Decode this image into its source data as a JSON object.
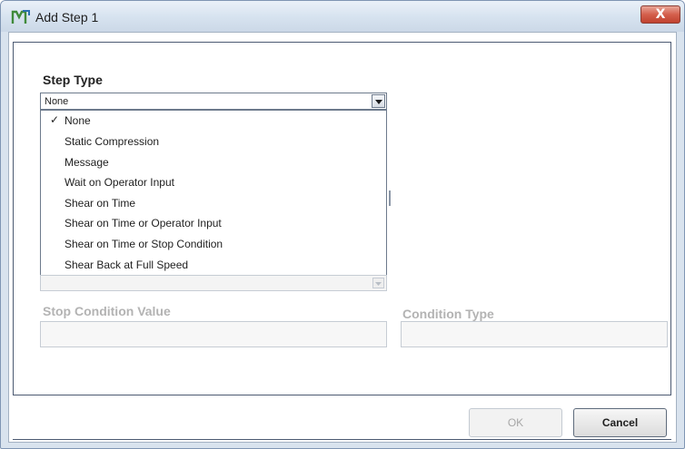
{
  "window": {
    "title": "Add Step 1",
    "close_label": "X"
  },
  "step_type": {
    "label": "Step Type",
    "selected": "None",
    "options": [
      {
        "label": "None",
        "checked": true
      },
      {
        "label": "Static Compression",
        "checked": false
      },
      {
        "label": "Message",
        "checked": false
      },
      {
        "label": "Wait on Operator Input",
        "checked": false
      },
      {
        "label": "Shear on Time",
        "checked": false
      },
      {
        "label": "Shear on Time or Operator Input",
        "checked": false
      },
      {
        "label": "Shear on Time or Stop Condition",
        "checked": false
      },
      {
        "label": "Shear Back at Full Speed",
        "checked": false
      }
    ],
    "check_glyph": "✓"
  },
  "stop_condition_value": {
    "label": "Stop Condition Value",
    "value": ""
  },
  "condition_type": {
    "label": "Condition Type",
    "value": ""
  },
  "buttons": {
    "ok": "OK",
    "cancel": "Cancel"
  },
  "colors": {
    "window_frame": "#d9e3ee",
    "close_button": "#c0422f",
    "disabled_text": "#b3b3b3"
  }
}
